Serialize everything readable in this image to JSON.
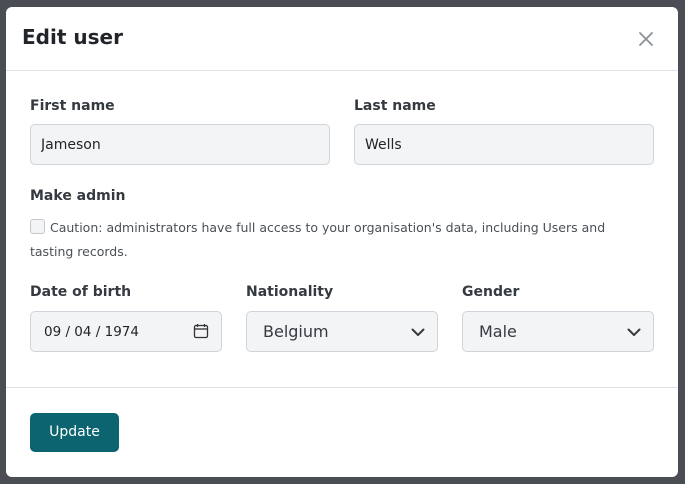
{
  "modal": {
    "title": "Edit user",
    "close_icon": "close-icon"
  },
  "form": {
    "first_name": {
      "label": "First name",
      "value": "Jameson"
    },
    "last_name": {
      "label": "Last name",
      "value": "Wells"
    },
    "make_admin": {
      "label": "Make admin",
      "checked": false,
      "caution": "Caution: administrators have full access to your organisation's data, including Users and tasting records."
    },
    "date_of_birth": {
      "label": "Date of birth",
      "value": "09 / 04 / 1974",
      "icon": "calendar-icon"
    },
    "nationality": {
      "label": "Nationality",
      "selected": "Belgium",
      "icon": "chevron-down-icon"
    },
    "gender": {
      "label": "Gender",
      "selected": "Male",
      "icon": "chevron-down-icon"
    }
  },
  "footer": {
    "update_label": "Update"
  },
  "colors": {
    "backdrop": "#4a4e54",
    "accent": "#0b6470",
    "input_background": "#f3f4f5"
  }
}
